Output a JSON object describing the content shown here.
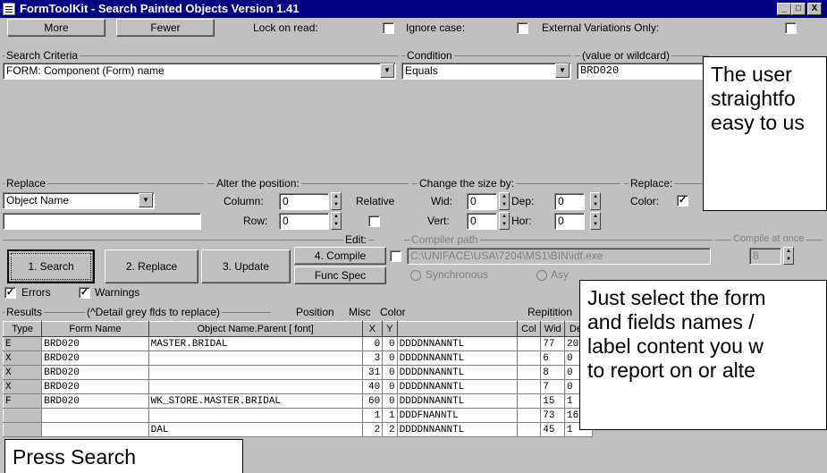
{
  "window": {
    "title": "FormToolKit - Search Painted Objects Version 1.41",
    "controls": [
      "_",
      "□",
      "X"
    ]
  },
  "toolbar": {
    "more": "More",
    "fewer": "Fewer",
    "lock_on_read": "Lock on read:",
    "ignore_case": "Ignore case:",
    "external_variations": "External Variations Only:"
  },
  "search_criteria": {
    "label": "Search Criteria",
    "field_value": "FORM: Component (Form) name",
    "condition_label": "Condition",
    "condition_value": "Equals",
    "value_label": "(value or wildcard)",
    "value": "BRD020"
  },
  "replace": {
    "label": "Replace",
    "target": "Object Name",
    "value": ""
  },
  "alter_position": {
    "label": "Alter the position:",
    "column_label": "Column:",
    "column": "0",
    "row_label": "Row:",
    "row": "0",
    "relative_label": "Relative"
  },
  "change_size": {
    "label": "Change the size by:",
    "wid_label": "Wid:",
    "wid": "0",
    "dep_label": "Dep:",
    "dep": "0",
    "vert_label": "Vert:",
    "vert": "0",
    "hor_label": "Hor:",
    "hor": "0"
  },
  "replace_color": {
    "label": "Replace:",
    "color_label": "Color:"
  },
  "compile": {
    "edit_label": "Edit:",
    "path_label": "Compiler path",
    "path": "C:\\UNIFACE\\USA\\7204\\MS1\\BIN\\idf.exe",
    "at_once_label": "Compile at once",
    "at_once": "8",
    "synchronous": "Synchronous",
    "async": "Asy"
  },
  "actions": {
    "search": "1. Search",
    "replace": "2. Replace",
    "update": "3. Update",
    "compile": "4. Compile",
    "func_spec": "Func Spec"
  },
  "filters": {
    "errors": "Errors",
    "warnings": "Warnings"
  },
  "results": {
    "label": "Results",
    "hint": "(^Detail grey flds to replace)",
    "position_label": "Position",
    "misc_label": "Misc",
    "color_label": "Color",
    "repitition_label": "Repitition",
    "columns": [
      "Type",
      "Form Name",
      "Object Name.Parent [ font]",
      "X",
      "Y",
      "",
      "Col",
      "Wid",
      "Dep"
    ],
    "rows": [
      [
        "E",
        "BRD020",
        "MASTER.BRIDAL",
        "0",
        "0",
        "DDDDNNANNTL",
        "",
        "77",
        "20"
      ],
      [
        "X",
        "BRD020",
        "",
        "3",
        "0",
        "DDDDNNANNTL",
        "",
        "6",
        "0"
      ],
      [
        "X",
        "BRD020",
        "",
        "31",
        "0",
        "DDDDNNANNTL",
        "",
        "8",
        "0"
      ],
      [
        "X",
        "BRD020",
        "",
        "40",
        "0",
        "DDDDNNANNTL",
        "",
        "7",
        "0"
      ],
      [
        "F",
        "BRD020",
        "WK_STORE.MASTER.BRIDAL",
        "60",
        "0",
        "DDDDNNANNTL",
        "",
        "15",
        "1"
      ],
      [
        "",
        "",
        "",
        "1",
        "1",
        "DDDFNANNTL",
        "",
        "73",
        "16"
      ],
      [
        "",
        "",
        "DAL",
        "2",
        "2",
        "DDDDNNANNTL",
        "",
        "45",
        "1"
      ]
    ]
  },
  "callouts": {
    "top": [
      "The user",
      "straightfo",
      "easy to us"
    ],
    "middle": [
      "Just select the form",
      "and fields names /",
      "label content you w",
      "to report on or alte"
    ],
    "bottom": "Press Search"
  },
  "colors": {
    "titlebar": "#000080",
    "face": "#c0c0c0"
  }
}
